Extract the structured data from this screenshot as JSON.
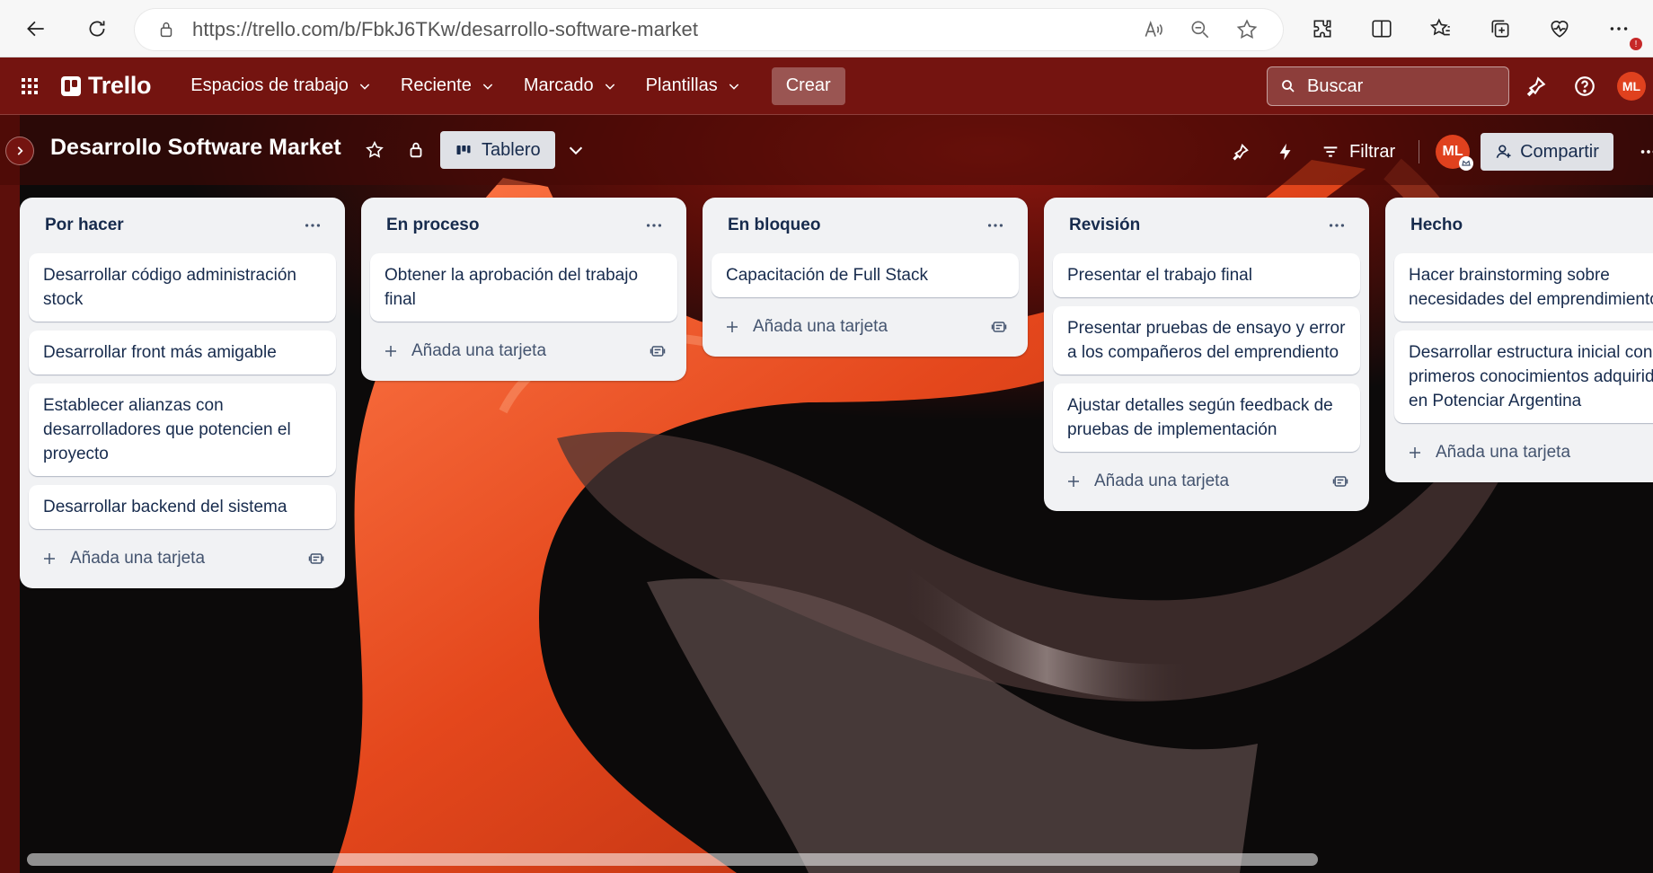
{
  "browser": {
    "url": "https://trello.com/b/FbkJ6TKw/desarrollo-software-market",
    "alerts_badge": "!"
  },
  "header": {
    "logo": "Trello",
    "nav": [
      {
        "label": "Espacios de trabajo"
      },
      {
        "label": "Reciente"
      },
      {
        "label": "Marcado"
      },
      {
        "label": "Plantillas"
      }
    ],
    "create_label": "Crear",
    "search_placeholder": "Buscar",
    "user_initials": "ML"
  },
  "board": {
    "title": "Desarrollo Software Market",
    "view_label": "Tablero",
    "filter_label": "Filtrar",
    "share_label": "Compartir",
    "member_initials": "ML"
  },
  "lists": [
    {
      "title": "Por hacer",
      "cards": [
        "Desarrollar código administración stock",
        "Desarrollar front más amigable",
        "Establecer alianzas con desarrolladores que potencien el proyecto",
        "Desarrollar backend del sistema"
      ],
      "add_label": "Añada una tarjeta"
    },
    {
      "title": "En proceso",
      "cards": [
        "Obtener la aprobación del trabajo final"
      ],
      "add_label": "Añada una tarjeta"
    },
    {
      "title": "En bloqueo",
      "cards": [
        "Capacitación de Full Stack"
      ],
      "add_label": "Añada una tarjeta"
    },
    {
      "title": "Revisión",
      "cards": [
        "Presentar el trabajo final",
        "Presentar pruebas de ensayo y error a los compañeros del emprendiento",
        "Ajustar detalles según feedback de pruebas de implementación"
      ],
      "add_label": "Añada una tarjeta"
    },
    {
      "title": "Hecho",
      "cards": [
        "Hacer brainstorming sobre necesidades del emprendimiento",
        "Desarrollar estructura inicial con primeros conocimientos adquiridos en Potenciar Argentina"
      ],
      "add_label": "Añada una tarjeta"
    }
  ],
  "colors": {
    "header_bg": "#741410",
    "list_bg": "#f1f2f4",
    "card_text": "#172b4d",
    "avatar": "#e0411e"
  }
}
